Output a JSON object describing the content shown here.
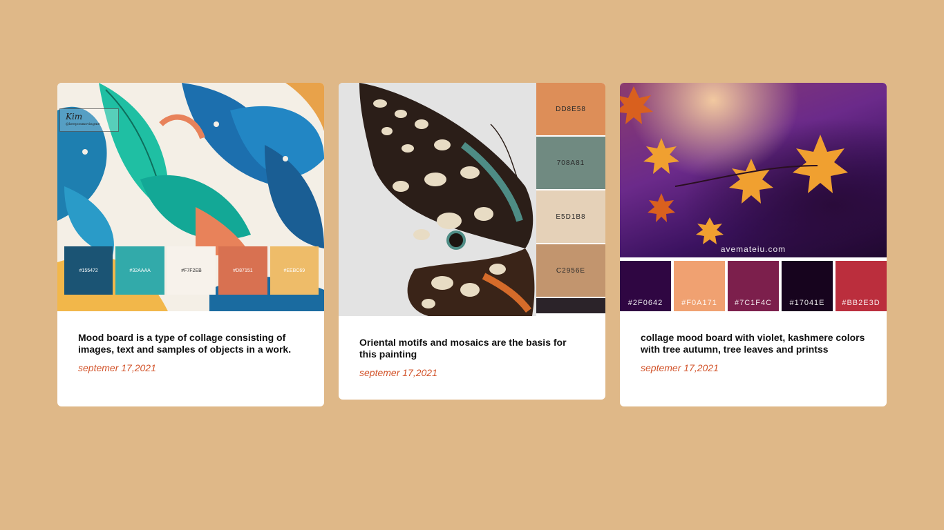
{
  "cards": [
    {
      "title": "Mood board is a type of collage consisting of images, text and samples of objects in a work.",
      "date": "septemer 17,2021",
      "signature": {
        "name": "Kim",
        "handle": "@keeponmovingme"
      },
      "swatches": [
        {
          "label": "#155472",
          "color": "#1B5474",
          "text_color": "#FFFFFF"
        },
        {
          "label": "#32AAAA",
          "color": "#32AAAA",
          "text_color": "#FFFFFF"
        },
        {
          "label": "#F7F2EB",
          "color": "#F7F2EB",
          "text_color": "#333333"
        },
        {
          "label": "#D87151",
          "color": "#D87151",
          "text_color": "#FFFFFF"
        },
        {
          "label": "#EEBC69",
          "color": "#EEBC69",
          "text_color": "#FFFFFF"
        }
      ]
    },
    {
      "title": "Oriental motifs and mosaics are the basis for this painting",
      "date": "septemer 17,2021",
      "swatches": [
        {
          "label": "DD8E58",
          "color": "#DD8E58"
        },
        {
          "label": "708A81",
          "color": "#708A81"
        },
        {
          "label": "E5D1B8",
          "color": "#E5D1B8"
        },
        {
          "label": "C2956E",
          "color": "#C2956E"
        }
      ]
    },
    {
      "title": "collage mood board with violet, kashmere colors with tree autumn, tree leaves and printss",
      "date": "septemer 17,2021",
      "watermark": "avemateiu.com",
      "swatches": [
        {
          "label": "#2F0642",
          "color": "#2F0642"
        },
        {
          "label": "#F0A171",
          "color": "#F0A171"
        },
        {
          "label": "#7C1F4C",
          "color": "#7C1F4C"
        },
        {
          "label": "#17041E",
          "color": "#17041E"
        },
        {
          "label": "#BB2E3D",
          "color": "#BB2E3D"
        }
      ]
    }
  ],
  "colors": {
    "page_background": "#DFB888",
    "date_accent": "#D2532A"
  }
}
